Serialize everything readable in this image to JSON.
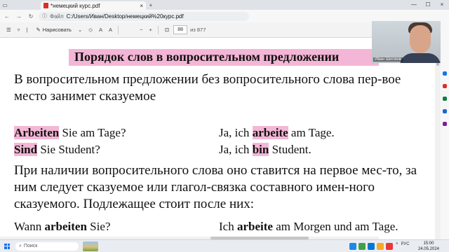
{
  "browser": {
    "tab_title": "*немецкий курс.pdf",
    "tab_close": "×",
    "new_tab": "+",
    "minimize": "—",
    "maximize": "☐",
    "close": "×",
    "back": "←",
    "forward": "→",
    "reload": "↻",
    "file_label": "Файл",
    "url": "C:/Users/Иван/Desktop/немецкий%20курс.pdf"
  },
  "pdf_toolbar": {
    "draw_label": "Нарисовать",
    "zoom_out": "−",
    "zoom_in": "+",
    "page_current": "88",
    "page_total": "из 877"
  },
  "document": {
    "heading": "Порядок слов в вопросительном предложении",
    "paragraph1": "В вопросительном предложении без вопросительного слова пер-вое место занимет сказуемое",
    "examples": [
      {
        "q_hl": "Arbeiten",
        "q_rest": " Sie am Tage?",
        "a_pre": "Ja, ich ",
        "a_hl": "arbeite",
        "a_post": " am Tage."
      },
      {
        "q_hl": "Sind",
        "q_rest": " Sie Student?",
        "a_pre": "Ja, ich ",
        "a_hl": "bin",
        "a_post": " Student."
      }
    ],
    "paragraph2": "При наличии вопросительного слова оно ставится на первое мес-то, за ним следует сказуемое или глагол-связка составного имен-ного сказуемого. Подлежащее стоит после них:",
    "example3": {
      "q_pre": "Wann ",
      "q_bold": "arbeiten",
      "q_post": " Sie?",
      "a_pre": "Ich ",
      "a_bold": "arbeite",
      "a_post": " am Morgen und am Tage."
    }
  },
  "webcam": {
    "name": "Иван Шиляев"
  },
  "taskbar": {
    "search_placeholder": "Поиск",
    "language": "РУС",
    "time": "15:00",
    "date": "24.05.2024"
  },
  "colors": {
    "highlight": "#f4b6d6",
    "windows_blue": "#1a73e8"
  }
}
